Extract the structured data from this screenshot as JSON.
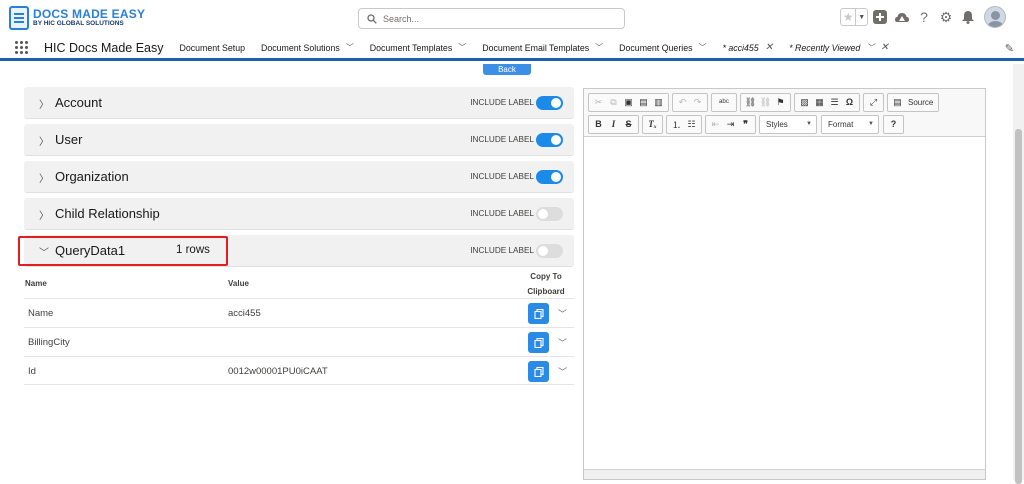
{
  "header": {
    "logo_title": "DOCS MADE EASY",
    "logo_subtitle": "BY HIC GLOBAL SOLUTIONS",
    "search_placeholder": "Search..."
  },
  "nav": {
    "app_name": "HIC Docs Made Easy",
    "items": [
      {
        "label": "Document Setup",
        "has_chevron": false
      },
      {
        "label": "Document Solutions",
        "has_chevron": true
      },
      {
        "label": "Document Templates",
        "has_chevron": true
      },
      {
        "label": "Document Email Templates",
        "has_chevron": true
      },
      {
        "label": "Document Queries",
        "has_chevron": true
      }
    ],
    "tabs": [
      {
        "label": "* acci455"
      },
      {
        "label": "* Recently Viewed"
      }
    ]
  },
  "main": {
    "back_label": "Back",
    "include_label_text": "INCLUDE LABEL",
    "sections": [
      {
        "title": "Account",
        "include_label": true
      },
      {
        "title": "User",
        "include_label": true
      },
      {
        "title": "Organization",
        "include_label": true
      },
      {
        "title": "Child Relationship",
        "include_label": false
      },
      {
        "title": "QueryData1",
        "rows": "1 rows",
        "include_label": false
      }
    ],
    "query_table": {
      "headers": {
        "name": "Name",
        "value": "Value",
        "copy_line1": "Copy To",
        "copy_line2": "Clipboard"
      },
      "rows": [
        {
          "name": "Name",
          "value": "acci455"
        },
        {
          "name": "BillingCity",
          "value": ""
        },
        {
          "name": "Id",
          "value": "0012w00001PU0iCAAT"
        }
      ]
    }
  },
  "editor": {
    "source_label": "Source",
    "styles_label": "Styles",
    "format_label": "Format",
    "help_label": "?"
  },
  "colors": {
    "accent": "#1b8ae8",
    "highlight": "#e02020",
    "nav_border": "#1b5fb4"
  }
}
